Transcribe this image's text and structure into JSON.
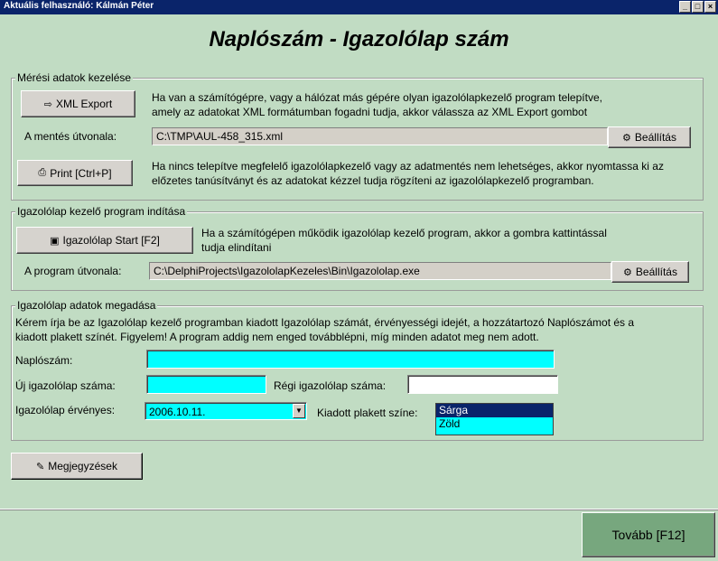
{
  "window": {
    "title": "Aktuális felhasználó: Kálmán Péter",
    "controls": [
      "_",
      "□",
      "×"
    ]
  },
  "heading": "Naplószám - Igazolólap szám",
  "export_group": {
    "legend": "Mérési adatok kezelése",
    "xml_button": "XML Export",
    "xml_icon": "export-icon",
    "xml_desc_line1": "Ha van a számítógépre, vagy a hálózat más gépére olyan igazolólapkezelő program telepítve,",
    "xml_desc_line2": "amely az adatokat XML formátumban fogadni tudja, akkor válassza az XML Export gombot",
    "save_path_label": "A mentés útvonala:",
    "save_path_value": "C:\\TMP\\AUL-458_315.xml",
    "settings_button": "Beállítás",
    "print_button": "Print [Ctrl+P]",
    "print_icon": "printer-icon",
    "print_desc_line1": "Ha nincs telepítve megfelelő igazolólapkezelő vagy az adatmentés nem lehetséges, akkor nyomtassa ki az",
    "print_desc_line2": "előzetes tanúsítványt és az adatokat kézzel tudja rögzíteni az igazolólapkezelő programban."
  },
  "start_group": {
    "legend": "Igazolólap kezelő program indítása",
    "start_button": "Igazolólap Start [F2]",
    "start_desc_line1": "Ha a számítógépen működik igazolólap kezelő program, akkor a gombra  kattintással",
    "start_desc_line2": "tudja elindítani",
    "program_path_label": "A program útvonala:",
    "program_path_value": "C:\\DelphiProjects\\IgazololapKezeles\\Bin\\Igazololap.exe",
    "settings_button": "Beállítás"
  },
  "data_group": {
    "legend": "Igazolólap adatok megadása",
    "instruction_line1": "Kérem írja be az Igazolólap kezelő programban kiadott Igazolólap számát, érvényességi idejét, a hozzátartozó Naplószámot és a",
    "instruction_line2": "kiadott plakett színét. Figyelem! A program addig nem enged továbblépni, míg minden adatot meg nem adott.",
    "naploszam_label": "Naplószám:",
    "naploszam_value": "",
    "uj_label": "Új igazolólap száma:",
    "uj_value": "",
    "regi_label": "Régi igazolólap száma:",
    "regi_value": "",
    "ervenyes_label": "Igazolólap érvényes:",
    "ervenyes_value": "2006.10.11.",
    "plakett_label": "Kiadott plakett színe:",
    "plakett_options": [
      "Sárga",
      "Zöld"
    ],
    "plakett_selected": "Sárga"
  },
  "notes_button": "Megjegyzések",
  "next_button": "Tovább [F12]",
  "colors": {
    "background": "#c1dcc3",
    "required_field": "#00ffff",
    "selection": "#0a246a",
    "next_button": "#77a77e"
  }
}
